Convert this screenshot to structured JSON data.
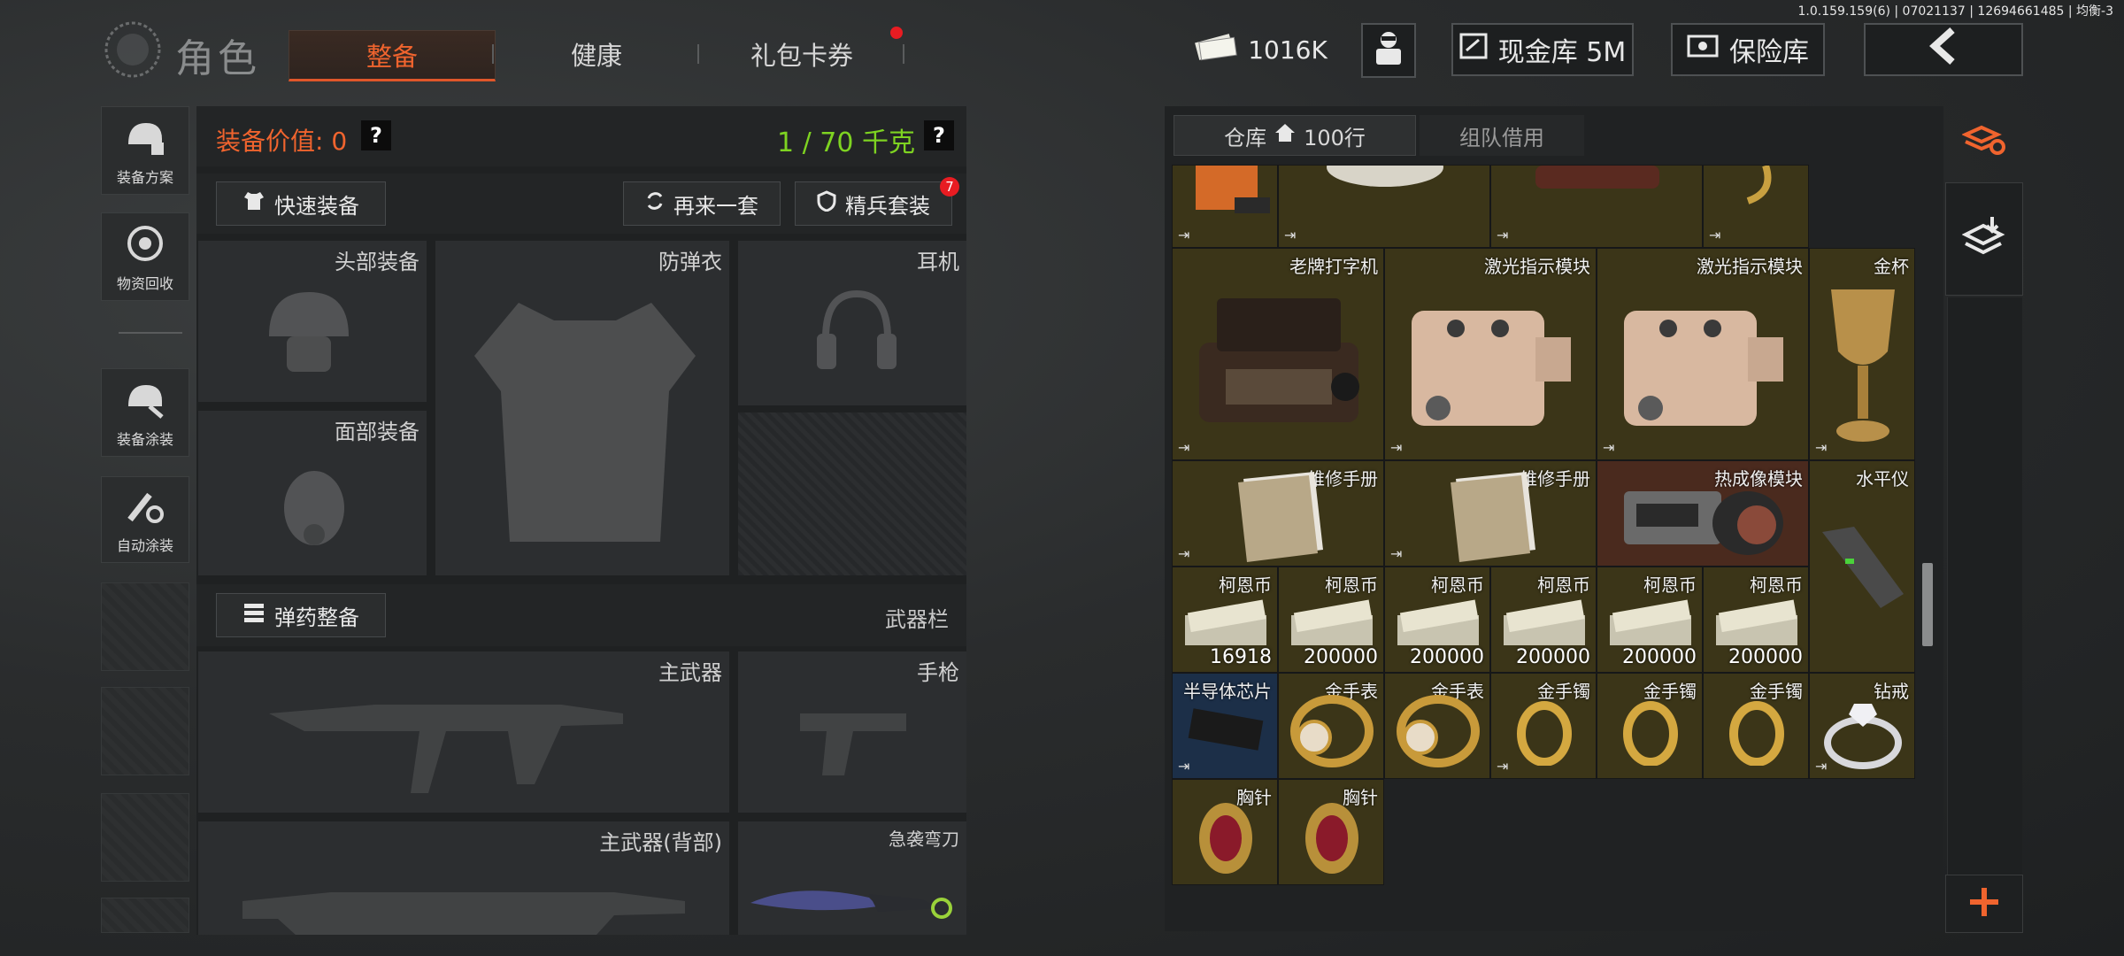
{
  "version": "1.0.159.159(6) | 07021137 | 12694661485 | 均衡-3",
  "header": {
    "title": "角色",
    "tabs": [
      "整备",
      "健康",
      "礼包卡券"
    ],
    "active_tab": 0,
    "money": "1016K",
    "cash_vault": "现金库 5M",
    "safe": "保险库"
  },
  "left_menu": [
    "装备方案",
    "物资回收",
    "装备涂装",
    "自动涂装"
  ],
  "equip": {
    "value_label": "装备价值: 0",
    "weight": "1 / 70 千克",
    "quick_equip": "快速装备",
    "again": "再来一套",
    "elite": "精兵套装",
    "elite_badge": "7",
    "slots": {
      "head": "头部装备",
      "armor": "防弹衣",
      "headset": "耳机",
      "face": "面部装备"
    },
    "ammo_btn": "弹药整备",
    "weapon_bar": "武器栏",
    "weapon_slots": {
      "primary": "主武器",
      "pistol": "手枪",
      "primary_back": "主武器(背部)",
      "knife": "急袭弯刀"
    }
  },
  "warehouse": {
    "tab_label": "仓库",
    "tab_rows": "100行",
    "team_tab": "组队借用",
    "items": [
      {
        "label": "老牌打字机",
        "icon": "typewriter-icon"
      },
      {
        "label": "激光指示模块",
        "icon": "laser-module-icon"
      },
      {
        "label": "激光指示模块",
        "icon": "laser-module-icon"
      },
      {
        "label": "金杯",
        "icon": "gold-cup-icon"
      },
      {
        "label": "维修手册",
        "icon": "manual-icon"
      },
      {
        "label": "维修手册",
        "icon": "manual-icon"
      },
      {
        "label": "热成像模块",
        "icon": "thermal-module-icon"
      },
      {
        "label": "水平仪",
        "icon": "level-icon"
      },
      {
        "label": "柯恩币",
        "count": "16918"
      },
      {
        "label": "柯恩币",
        "count": "200000"
      },
      {
        "label": "柯恩币",
        "count": "200000"
      },
      {
        "label": "柯恩币",
        "count": "200000"
      },
      {
        "label": "柯恩币",
        "count": "200000"
      },
      {
        "label": "柯恩币",
        "count": "200000"
      },
      {
        "label": "半导体芯片",
        "icon": "chip-icon"
      },
      {
        "label": "金手表",
        "icon": "gold-watch-icon"
      },
      {
        "label": "金手表",
        "icon": "gold-watch-icon"
      },
      {
        "label": "金手镯",
        "icon": "gold-bracelet-icon"
      },
      {
        "label": "金手镯",
        "icon": "gold-bracelet-icon"
      },
      {
        "label": "金手镯",
        "icon": "gold-bracelet-icon"
      },
      {
        "label": "钻戒",
        "icon": "diamond-ring-icon"
      },
      {
        "label": "胸针",
        "icon": "brooch-icon"
      },
      {
        "label": "胸针",
        "icon": "brooch-icon"
      }
    ]
  },
  "colors": {
    "accent": "#f0642e",
    "weight": "#7ed321",
    "gold_cell": "#3b3518"
  }
}
